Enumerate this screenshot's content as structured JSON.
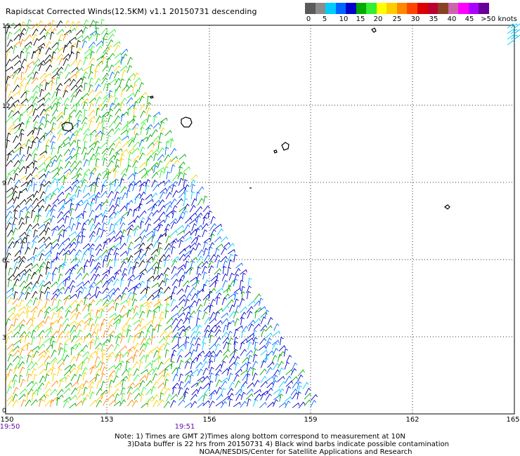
{
  "title": "Rapidscat Corrected Winds(12.5KM) v1.1 20150731 descending",
  "colorbar": {
    "labels": [
      "0",
      "5",
      "10",
      "15",
      "20",
      "25",
      "30",
      "35",
      "40",
      "45",
      ">50 knots"
    ],
    "colors": [
      "#5a5a5a",
      "#8c8c8c",
      "#00ccff",
      "#0066ff",
      "#0000cc",
      "#00aa00",
      "#33ee33",
      "#ffff00",
      "#ffcc00",
      "#ff8800",
      "#ff4400",
      "#dd0000",
      "#bb0033",
      "#884422",
      "#cc66aa",
      "#ff00ff",
      "#aa00ff",
      "#660099"
    ]
  },
  "map": {
    "x_ticks": [
      "150",
      "153",
      "156",
      "159",
      "162",
      "165"
    ],
    "y_ticks": [
      "0",
      "3",
      "6",
      "9",
      "12",
      "15"
    ],
    "pass_times": [
      "19:50",
      "19:51"
    ]
  },
  "notes": {
    "line1": "Note: 1) Times are GMT 2)Times along bottom correspond to measurement at 10N",
    "line2": "3)Data buffer is 22 hrs from 20150731 4) Black wind barbs indicate possible contamination",
    "line3": "NOAA/NESDIS/Center for Satellite Applications and Research"
  }
}
